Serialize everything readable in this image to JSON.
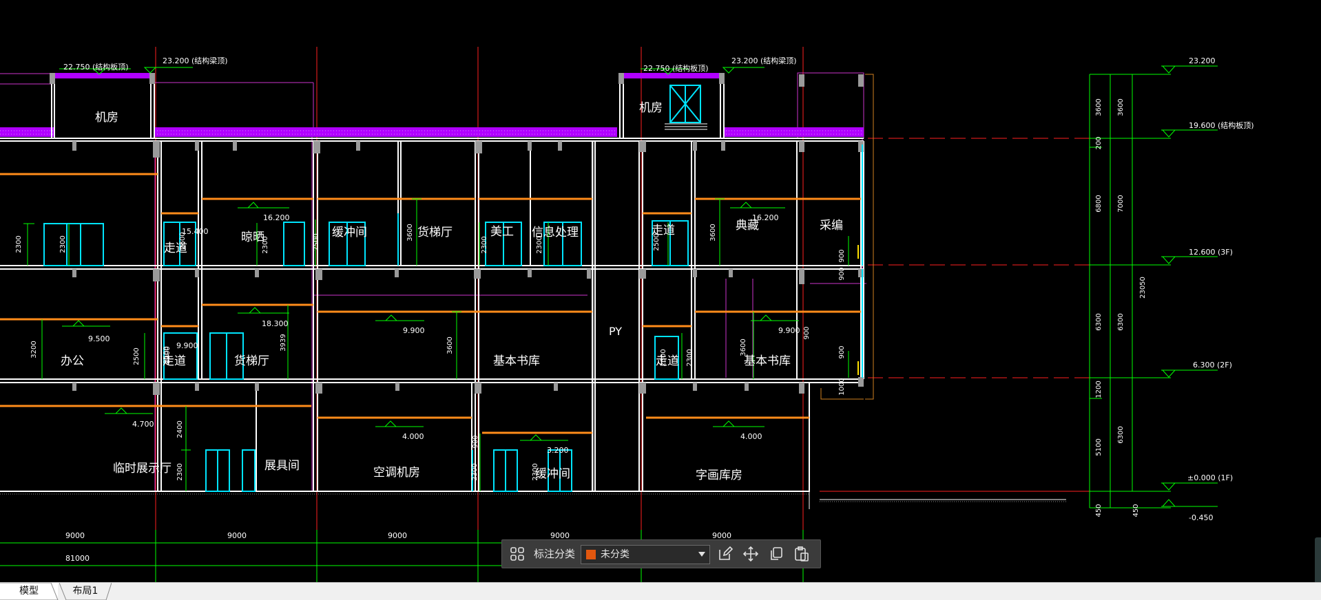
{
  "colors": {
    "background": "#000000",
    "wall": "#ffffff",
    "roof": "#b000ff",
    "axis": "#ff2020",
    "dimension": "#00ff00",
    "door": "#00ffff",
    "beam": "#ff8c1a",
    "outline": "#cc33cc",
    "tag_swatch": "#e2570f"
  },
  "drawing": {
    "top_labels": [
      "22.750 (结构板顶)",
      "23.200 (结构梁顶)",
      "22.750 (结构板顶)",
      "23.200 (结构梁顶)"
    ],
    "rooms": [
      "机房",
      "机房",
      "走道",
      "晾晒",
      "缓冲间",
      "货梯厅",
      "美工",
      "信息处理",
      "走道",
      "典藏",
      "采编",
      "办公",
      "走道",
      "货梯厅",
      "基本书库",
      "PY",
      "走道",
      "基本书库",
      "临时展示厅",
      "展具间",
      "空调机房",
      "缓冲间",
      "字画库房"
    ],
    "spot_levels": [
      "16.200",
      "16.200",
      "9.500",
      "18.300",
      "9.900",
      "9.900",
      "4.700",
      "4.000",
      "4.000",
      "3.200",
      "9.900",
      "15.400"
    ],
    "inner_dims": [
      "2300",
      "2300",
      "2300",
      "2500",
      "2500",
      "3600",
      "2300",
      "2300",
      "2500",
      "3600",
      "3200",
      "2500",
      "2300",
      "2300",
      "3939",
      "3600",
      "2500",
      "2300",
      "3600",
      "2400",
      "2300",
      "900",
      "2300",
      "2300",
      "900",
      "900",
      "900",
      "1000",
      "900"
    ],
    "right_levels": [
      "23.200",
      "19.600 (结构板顶)",
      "12.600 (3F)",
      "6.300 (2F)",
      "±0.000 (1F)",
      "-0.450"
    ],
    "right_dims_outer": [
      "3600",
      "200",
      "6800",
      "6300",
      "1200",
      "5100",
      "450"
    ],
    "right_dims_inner": [
      "3600",
      "7000",
      "6300",
      "6300",
      "450"
    ],
    "right_total": "23050",
    "bottom_bays": [
      "9000",
      "9000",
      "9000",
      "9000",
      "9000"
    ],
    "bottom_total": "81000"
  },
  "toolbar": {
    "grid_icon": "grid-icon",
    "label": "标注分类",
    "selected": "未分类",
    "edit_icon": "edit-icon",
    "move_icon": "move-icon",
    "copy_icon": "copy-icon",
    "paste_icon": "paste-icon"
  },
  "tabs": {
    "model": "模型",
    "layout1": "布局1"
  }
}
